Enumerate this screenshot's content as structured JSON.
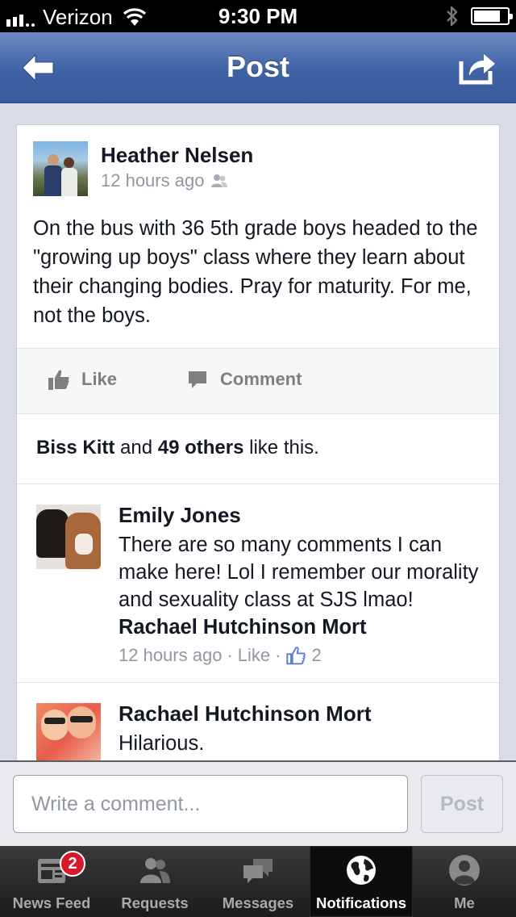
{
  "status_bar": {
    "carrier": "Verizon",
    "time": "9:30 PM"
  },
  "nav": {
    "title": "Post"
  },
  "post": {
    "author": "Heather Nelsen",
    "time": "12 hours ago",
    "text": "On the bus with 36 5th grade boys headed to the \"growing up boys\" class where they learn about their changing bodies. Pray for maturity. For me, not the  boys.",
    "like_label": "Like",
    "comment_label": "Comment",
    "likes": {
      "name": "Biss Kitt",
      "connector": "and",
      "others": "49 others",
      "suffix": "like this."
    }
  },
  "comments": [
    {
      "author": "Emily Jones",
      "text": "There are so many comments I can make here! Lol I remember  our morality and sexuality class at SJS lmao!",
      "mention": "Rachael Hutchinson Mort",
      "time": "12 hours ago",
      "like_label": "Like",
      "like_count": "2"
    },
    {
      "author": "Rachael Hutchinson Mort",
      "text": "Hilarious."
    }
  ],
  "composer": {
    "placeholder": "Write a comment...",
    "post_label": "Post"
  },
  "tabs": [
    {
      "label": "News Feed",
      "icon": "news-feed-icon",
      "badge": "2"
    },
    {
      "label": "Requests",
      "icon": "requests-icon"
    },
    {
      "label": "Messages",
      "icon": "messages-icon"
    },
    {
      "label": "Notifications",
      "icon": "globe-icon",
      "active": true
    },
    {
      "label": "Me",
      "icon": "profile-icon"
    }
  ]
}
